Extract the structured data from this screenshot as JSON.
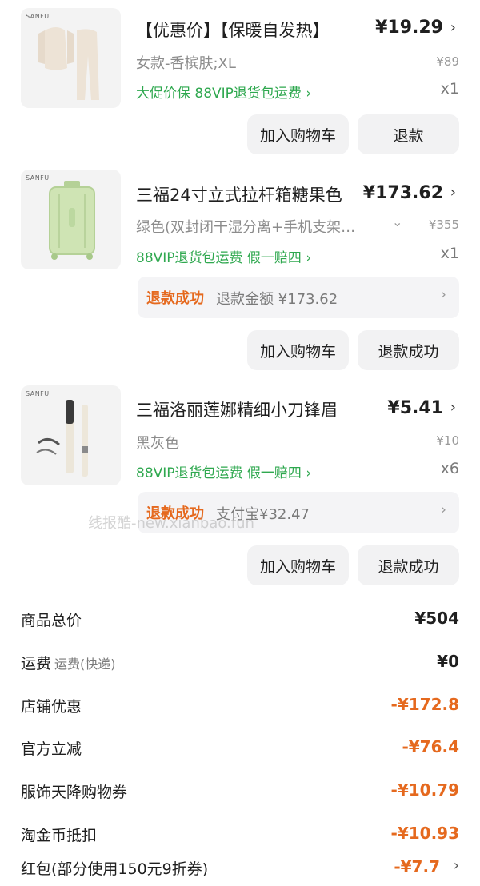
{
  "items": [
    {
      "brand": "SANFU",
      "title": "【优惠价】【保暖自发热】",
      "price": "¥19.29",
      "sku": "女款-香槟肤;XL",
      "original_price": "¥89",
      "tags": "大促价保  88VIP退货包运费 ›",
      "qty": "x1",
      "buttons": [
        "加入购物车",
        "退款"
      ]
    },
    {
      "brand": "SANFU",
      "title": "三福24寸立式拉杆箱糖果色",
      "price": "¥173.62",
      "sku": "绿色(双封闭干湿分离+手机支架…",
      "original_price": "¥355",
      "tags": "88VIP退货包运费  假一赔四 ›",
      "qty": "x1",
      "refund": {
        "status": "退款成功",
        "text": "退款金额 ¥173.62"
      },
      "buttons": [
        "加入购物车",
        "退款成功"
      ]
    },
    {
      "brand": "SANFU",
      "title": "三福洛丽莲娜精细小刀锋眉",
      "price": "¥5.41",
      "sku": "黑灰色",
      "original_price": "¥10",
      "tags": "88VIP退货包运费  假一赔四 ›",
      "qty": "x6",
      "refund": {
        "status": "退款成功",
        "text": "支付宝¥32.47"
      },
      "buttons": [
        "加入购物车",
        "退款成功"
      ]
    }
  ],
  "watermark": "线报酷-new.xianbao.fun",
  "summary": [
    {
      "label": "商品总价",
      "sub": "",
      "value": "¥504"
    },
    {
      "label": "运费",
      "sub": "运费(快递)",
      "value": "¥0"
    },
    {
      "label": "店铺优惠",
      "sub": "",
      "value": "-¥172.8"
    },
    {
      "label": "官方立减",
      "sub": "",
      "value": "-¥76.4"
    },
    {
      "label": "服饰天降购物券",
      "sub": "",
      "value": "-¥10.79"
    },
    {
      "label": "淘金币抵扣",
      "sub": "",
      "value": "-¥10.93"
    },
    {
      "label": "红包(部分使用150元9折券)",
      "sub": "",
      "value": "-¥7.7"
    }
  ],
  "icons": {
    "chevron": "chevron-right-icon",
    "dropdown": "chevron-down-icon"
  },
  "colors": {
    "green": "#2fa84f",
    "orange": "#e5691e",
    "button_bg": "#f2f2f3"
  }
}
